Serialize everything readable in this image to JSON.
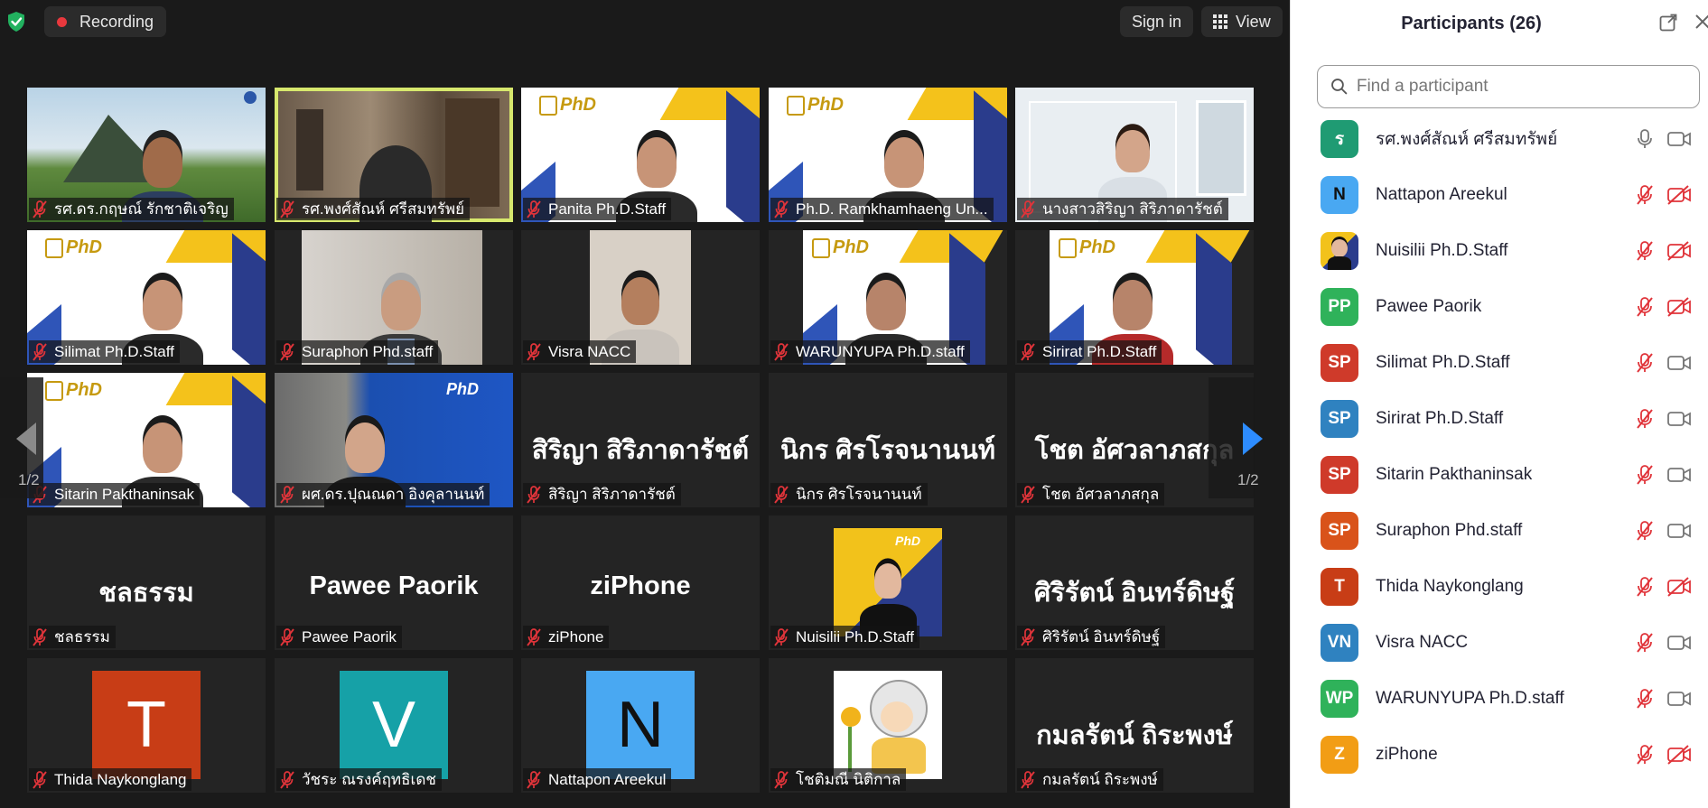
{
  "topbar": {
    "recording_label": "Recording",
    "signin_label": "Sign in",
    "view_label": "View"
  },
  "gallery": {
    "page_left": "1/2",
    "page_right": "1/2",
    "tiles": [
      {
        "name": "รศ.ดร.กฤษณ์ รักชาติเจริญ",
        "big": "",
        "kind": "video-architecture"
      },
      {
        "name": "รศ.พงศ์สัณห์ ศรีสมทรัพย์",
        "big": "",
        "kind": "video-room",
        "speaking": true
      },
      {
        "name": "Panita Ph.D.Staff",
        "big": "",
        "kind": "video-brand"
      },
      {
        "name": "Ph.D. Ramkhamhaeng Un...",
        "big": "",
        "kind": "video-brand"
      },
      {
        "name": "นางสาวสิริญา สิริภาดารัชต์",
        "big": "",
        "kind": "video-office"
      },
      {
        "name": "Silimat Ph.D.Staff",
        "big": "",
        "kind": "video-brand"
      },
      {
        "name": "Suraphon Phd.staff",
        "big": "",
        "kind": "video-home"
      },
      {
        "name": "Visra NACC",
        "big": "",
        "kind": "video-plain"
      },
      {
        "name": "WARUNYUPA Ph.D.staff",
        "big": "",
        "kind": "video-brand-small"
      },
      {
        "name": "Sirirat Ph.D.Staff",
        "big": "",
        "kind": "video-brand-small"
      },
      {
        "name": "Sitarin Pakthaninsak",
        "big": "",
        "kind": "video-brand"
      },
      {
        "name": "ผศ.ดร.ปุณณดา อิงคุลานนท์",
        "big": "",
        "kind": "video-blue"
      },
      {
        "name": "สิริญา สิริภาดารัชต์",
        "big": "สิริญา สิริภาดารัชต์",
        "kind": "text"
      },
      {
        "name": "นิกร ศิรโรจนานนท์",
        "big": "นิกร ศิรโรจนานนท์",
        "kind": "text"
      },
      {
        "name": "โชต อัศวลาภสกุล",
        "big": "โชต อัศวลาภสกุล",
        "kind": "text"
      },
      {
        "name": "ชลธรรม",
        "big": "ชลธรรม",
        "kind": "text"
      },
      {
        "name": "Pawee  Paorik",
        "big": "Pawee  Paorik",
        "kind": "text"
      },
      {
        "name": "ziPhone",
        "big": "ziPhone",
        "kind": "text"
      },
      {
        "name": "Nuisilii Ph.D.Staff",
        "big": "",
        "kind": "photo-brand"
      },
      {
        "name": "ศิริรัตน์ อินทร์ดิษฐ์",
        "big": "ศิริรัตน์ อินทร์ดิษฐ์",
        "kind": "text"
      },
      {
        "name": "Thida Naykonglang",
        "big": "T",
        "kind": "avatar",
        "color": "#c83d16"
      },
      {
        "name": "วัชระ ณรงค์ฤทธิเดช",
        "big": "V",
        "kind": "avatar",
        "color": "#16a1a7"
      },
      {
        "name": "Nattapon Areekul",
        "big": "N",
        "kind": "avatar",
        "color": "#49a8f2",
        "dark": true
      },
      {
        "name": "โชติมณี นิติกาล",
        "big": "",
        "kind": "avatar-drawing"
      },
      {
        "name": "กมลรัตน์ ถิระพงษ์",
        "big": "กมลรัตน์ ถิระพงษ์",
        "kind": "text"
      }
    ]
  },
  "sidebar": {
    "title": "Participants (26)",
    "search_placeholder": "Find a participant",
    "participants": [
      {
        "initials": "ร",
        "name": "รศ.พงศ์สัณห์ ศรีสมทรัพย์",
        "color": "#1f9b73",
        "mic": "on",
        "cam": "on"
      },
      {
        "initials": "N",
        "name": "Nattapon Areekul",
        "color": "#49a8f2",
        "dark": true,
        "mic": "off",
        "cam": "off"
      },
      {
        "initials": "",
        "name": "Nuisilii Ph.D.Staff",
        "color": "#f2b81b",
        "photo": true,
        "mic": "off",
        "cam": "off"
      },
      {
        "initials": "PP",
        "name": "Pawee  Paorik",
        "color": "#2fb25a",
        "mic": "off",
        "cam": "off"
      },
      {
        "initials": "SP",
        "name": "Silimat Ph.D.Staff",
        "color": "#cf3a2a",
        "mic": "off",
        "cam": "on"
      },
      {
        "initials": "SP",
        "name": "Sirirat Ph.D.Staff",
        "color": "#2f82c0",
        "mic": "off",
        "cam": "on"
      },
      {
        "initials": "SP",
        "name": "Sitarin Pakthaninsak",
        "color": "#cf3a2a",
        "mic": "off",
        "cam": "on"
      },
      {
        "initials": "SP",
        "name": "Suraphon Phd.staff",
        "color": "#d9531a",
        "mic": "off",
        "cam": "on"
      },
      {
        "initials": "T",
        "name": "Thida Naykonglang",
        "color": "#c83d16",
        "mic": "off",
        "cam": "off"
      },
      {
        "initials": "VN",
        "name": "Visra NACC",
        "color": "#2f82c0",
        "mic": "off",
        "cam": "on"
      },
      {
        "initials": "WP",
        "name": "WARUNYUPA Ph.D.staff",
        "color": "#2fb25a",
        "mic": "off",
        "cam": "on"
      },
      {
        "initials": "Z",
        "name": "ziPhone",
        "color": "#f29d15",
        "mic": "off",
        "cam": "off"
      }
    ]
  },
  "colors": {
    "speaking_border": "#d7e86d",
    "muted_red": "#e0343a",
    "gallery_bg": "#1a1a1a",
    "nav_arrow_blue": "#2d8cff"
  }
}
